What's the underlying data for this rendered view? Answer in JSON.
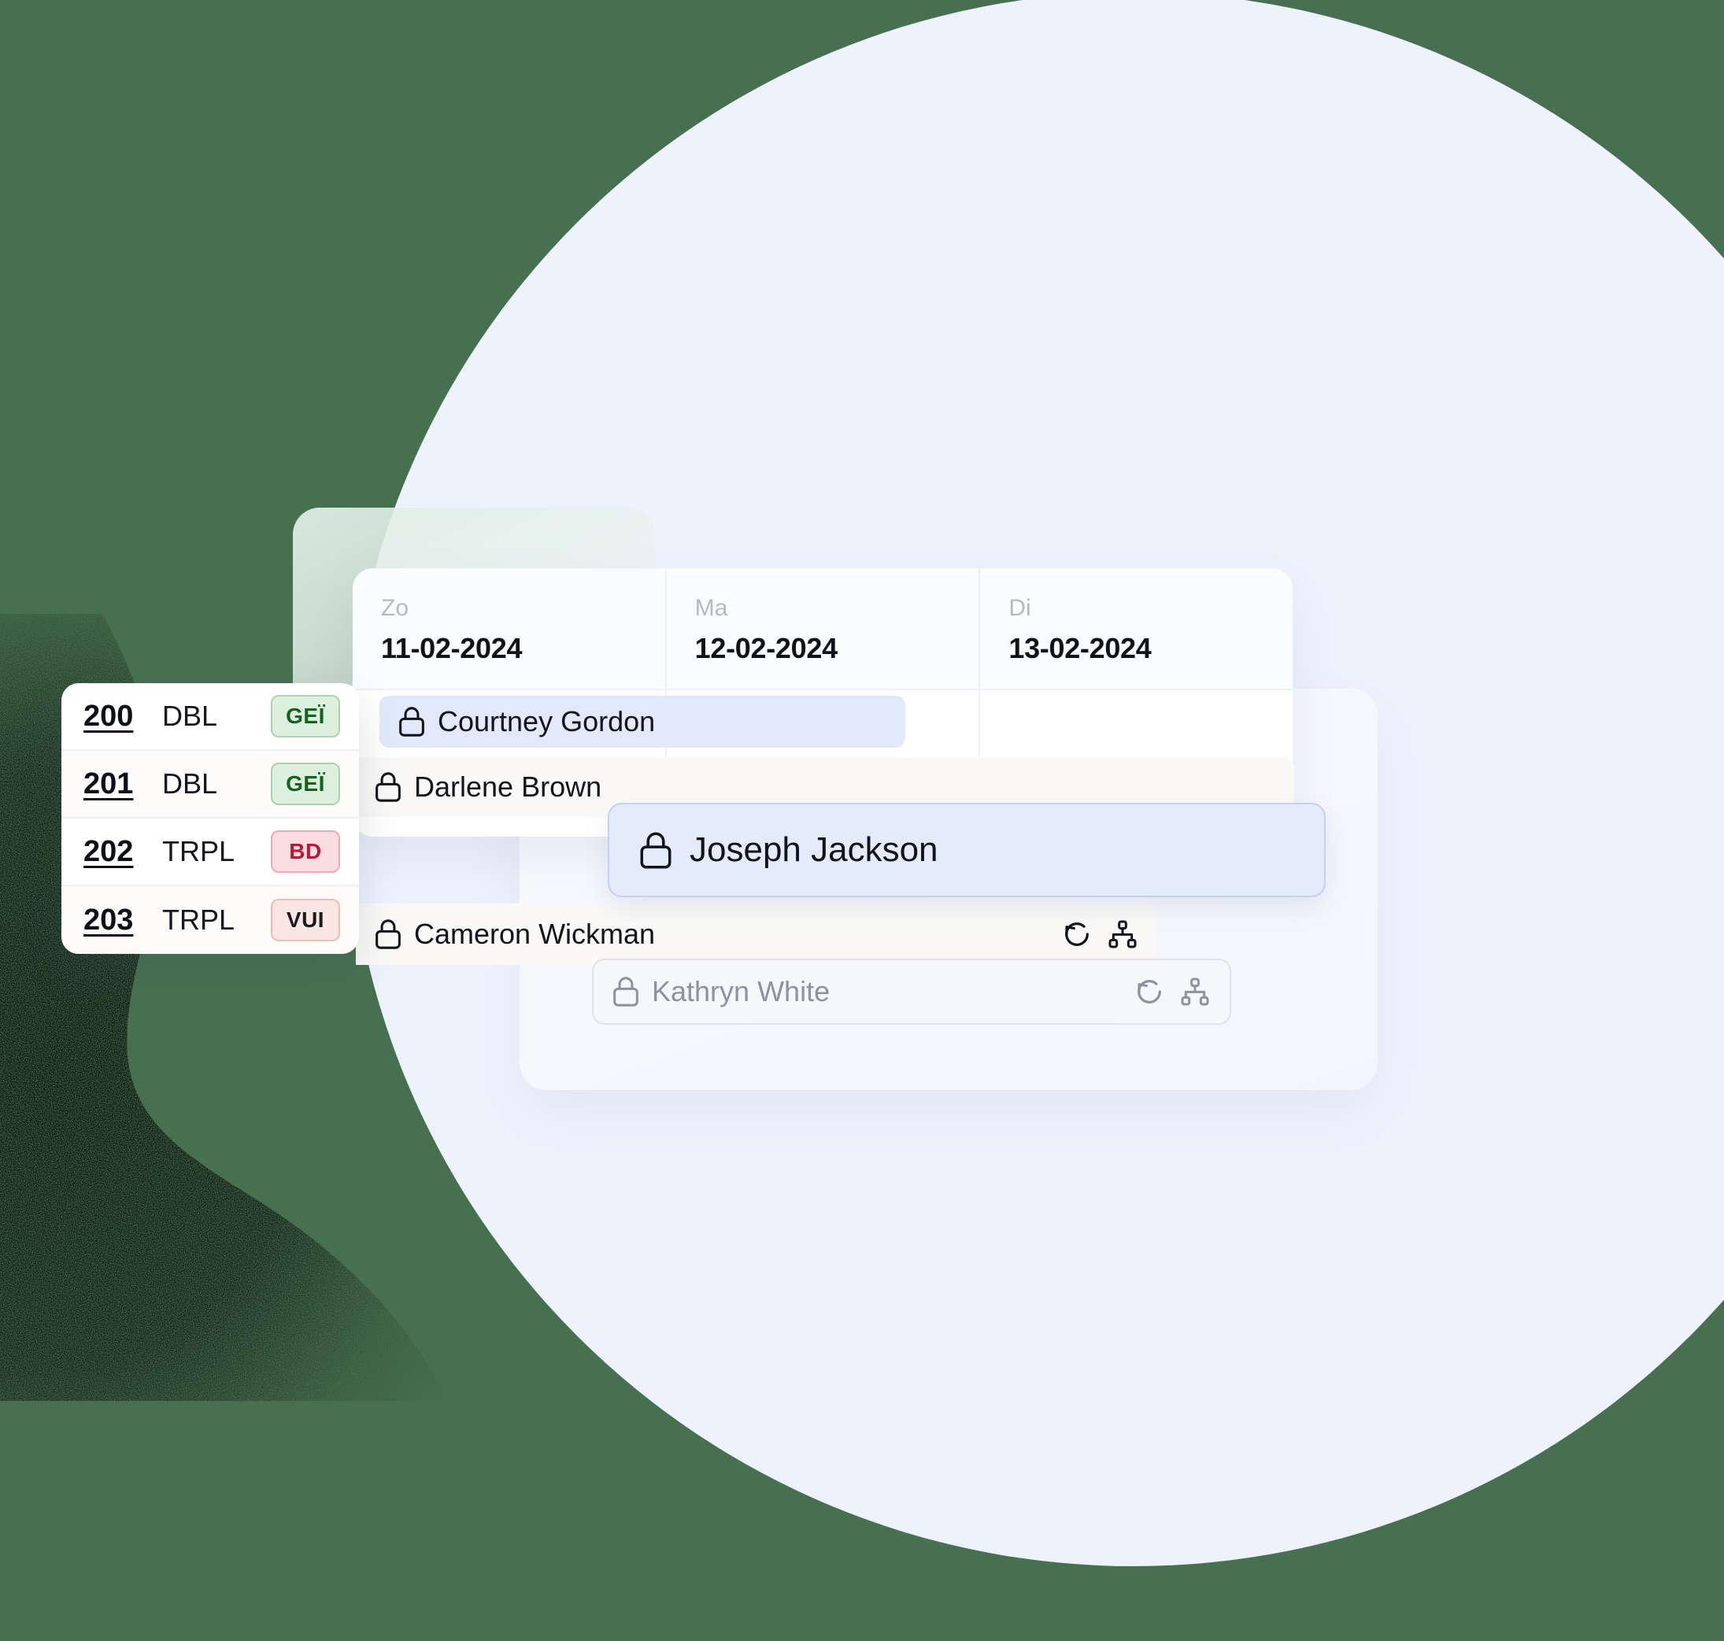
{
  "theme": {
    "canvas_bg": "#477050",
    "circle_bg": "#eef2fd",
    "panel_bg": "#ffffff",
    "accent_blue": "#e2e9fb",
    "accent_blue_border": "#c5d2ef",
    "row_tint": "#faf9f7",
    "tag_green_bg": "#ddf0de",
    "tag_green_text": "#14621f",
    "tag_red_bg": "#fadde0",
    "tag_red_text": "#b8183a",
    "tag_pink_bg": "#fbe6e4",
    "muted_text": "#b4bac4"
  },
  "calendar": {
    "columns": [
      {
        "day": "Zo",
        "date": "11-02-2024"
      },
      {
        "day": "Ma",
        "date": "12-02-2024"
      },
      {
        "day": "Di",
        "date": "13-02-2024"
      }
    ]
  },
  "rooms": {
    "items": [
      {
        "number": "200",
        "type": "DBL",
        "tag": "GEÏ",
        "tag_style": "green"
      },
      {
        "number": "201",
        "type": "DBL",
        "tag": "GEÏ",
        "tag_style": "green"
      },
      {
        "number": "202",
        "type": "TRPL",
        "tag": "BD",
        "tag_style": "red"
      },
      {
        "number": "203",
        "type": "TRPL",
        "tag": "VUI",
        "tag_style": "pink"
      }
    ]
  },
  "bookings": [
    {
      "id": "courtney",
      "guest": "Courtney Gordon",
      "locked": true,
      "has_actions": false,
      "state": "selected"
    },
    {
      "id": "darlene",
      "guest": "Darlene Brown",
      "locked": true,
      "has_actions": false,
      "state": "default"
    },
    {
      "id": "joseph",
      "guest": "Joseph Jackson",
      "locked": true,
      "has_actions": false,
      "state": "dragging"
    },
    {
      "id": "cameron",
      "guest": "Cameron Wickman",
      "locked": true,
      "has_actions": true,
      "state": "default"
    },
    {
      "id": "kathryn",
      "guest": "Kathryn White",
      "locked": true,
      "has_actions": true,
      "state": "ghost"
    }
  ],
  "icons": {
    "lock": "lock-icon",
    "restore": "restore-rotate-icon",
    "hierarchy": "hierarchy-sitemap-icon"
  }
}
